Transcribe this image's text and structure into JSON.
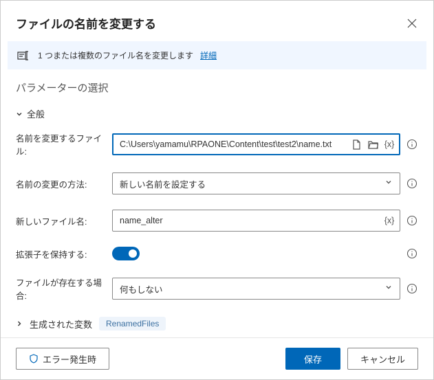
{
  "header": {
    "title": "ファイルの名前を変更する"
  },
  "info_bar": {
    "text": "1 つまたは複数のファイル名を変更します",
    "link": "詳細"
  },
  "params_title": "パラメーターの選択",
  "group_general": "全般",
  "fields": {
    "file_to_rename": {
      "label": "名前を変更するファイル:",
      "value": "C:\\Users\\yamamu\\RPAONE\\Content\\test\\test2\\name.txt"
    },
    "rename_method": {
      "label": "名前の変更の方法:",
      "value": "新しい名前を設定する"
    },
    "new_name": {
      "label": "新しいファイル名:",
      "value": "name_alter"
    },
    "keep_ext": {
      "label": "拡張子を保持する:"
    },
    "if_exists": {
      "label": "ファイルが存在する場合:",
      "value": "何もしない"
    }
  },
  "generated_vars": {
    "label": "生成された変数",
    "badge": "RenamedFiles"
  },
  "footer": {
    "error": "エラー発生時",
    "save": "保存",
    "cancel": "キャンセル"
  },
  "var_token": "{x}"
}
